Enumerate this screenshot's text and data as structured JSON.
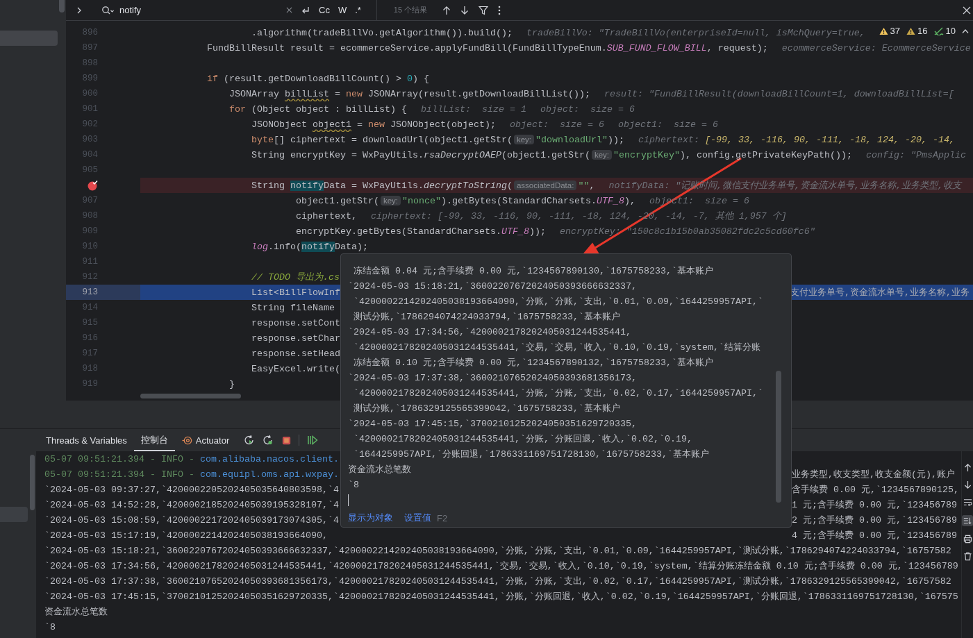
{
  "find_bar": {
    "query": "notify",
    "options": [
      "Cc",
      "W",
      ".*"
    ],
    "result_count": "15 个结果"
  },
  "inspections": [
    {
      "kind": "warning",
      "count": "37"
    },
    {
      "kind": "weak_warning",
      "count": "16"
    },
    {
      "kind": "typo",
      "count": "10"
    }
  ],
  "editor": {
    "lines": [
      {
        "number": "896",
        "breakpoint": false,
        "current": false,
        "segments": [
          {
            "kind": "plain",
            "text": "                    .algorithm(tradeBillVo.getAlgorithm()).build();"
          },
          {
            "kind": "hint",
            "text": "tradeBillVo: \"TradeBillVo(enterpriseId=null, isMchQuery=true,"
          }
        ]
      },
      {
        "number": "897",
        "breakpoint": false,
        "current": false,
        "segments": [
          {
            "kind": "plain",
            "text": "            FundBillResult result = ecommerceService.applyFundBill(FundBillTypeEnum."
          },
          {
            "kind": "constant",
            "text": "SUB_FUND_FLOW_BILL"
          },
          {
            "kind": "plain",
            "text": ", request);"
          },
          {
            "kind": "hint",
            "text": "ecommerceService: EcommerceService"
          }
        ]
      },
      {
        "number": "898",
        "breakpoint": false,
        "current": false
      },
      {
        "number": "899",
        "breakpoint": false,
        "current": false,
        "segments": [
          {
            "kind": "keyword",
            "text": "            if"
          },
          {
            "kind": "plain",
            "text": " (result.getDownloadBillCount() > "
          },
          {
            "kind": "number",
            "text": "0"
          },
          {
            "kind": "plain",
            "text": ") {"
          }
        ]
      },
      {
        "number": "900",
        "breakpoint": false,
        "current": false,
        "segments": [
          {
            "kind": "plain",
            "text": "                JSONArray "
          },
          {
            "kind": "warn",
            "text": "billList"
          },
          {
            "kind": "plain",
            "text": " = "
          },
          {
            "kind": "keyword",
            "text": "new"
          },
          {
            "kind": "plain",
            "text": " JSONArray(result.getDownloadBillList());"
          },
          {
            "kind": "hint",
            "text": "result: \"FundBillResult(downloadBillCount=1, downloadBillList=["
          }
        ]
      },
      {
        "number": "901",
        "breakpoint": false,
        "current": false,
        "segments": [
          {
            "kind": "keyword",
            "text": "                for"
          },
          {
            "kind": "plain",
            "text": " (Object object : billList) {"
          },
          {
            "kind": "hint",
            "text": "billList:  size = 1"
          },
          {
            "kind": "hint",
            "text": "object:  size = 6"
          }
        ]
      },
      {
        "number": "902",
        "breakpoint": false,
        "current": false,
        "segments": [
          {
            "kind": "plain",
            "text": "                    JSONObject "
          },
          {
            "kind": "warn",
            "text": "object1"
          },
          {
            "kind": "plain",
            "text": " = "
          },
          {
            "kind": "keyword",
            "text": "new"
          },
          {
            "kind": "plain",
            "text": " JSONObject(object);"
          },
          {
            "kind": "hint",
            "text": "object:  size = 6"
          },
          {
            "kind": "hint",
            "text": "object1:  size = 6"
          }
        ]
      },
      {
        "number": "903",
        "breakpoint": false,
        "current": false,
        "segments": [
          {
            "kind": "keyword",
            "text": "                    byte"
          },
          {
            "kind": "plain",
            "text": "[] ciphertext = downloadUrl(object1.getStr("
          },
          {
            "kind": "param",
            "text": "key:"
          },
          {
            "kind": "string",
            "text": "\"downloadUrl\""
          },
          {
            "kind": "plain",
            "text": "));"
          },
          {
            "kind": "hint",
            "text": "ciphertext:"
          },
          {
            "kind": "changed",
            "text": "[-99, 33, -116, 90, -111, -18, 124, -20, -14,"
          }
        ]
      },
      {
        "number": "904",
        "breakpoint": false,
        "current": false,
        "segments": [
          {
            "kind": "plain",
            "text": "                    String encryptKey = WxPayUtils."
          },
          {
            "kind": "static",
            "text": "rsaDecryptOAEP"
          },
          {
            "kind": "plain",
            "text": "(object1.getStr("
          },
          {
            "kind": "param",
            "text": "key:"
          },
          {
            "kind": "string",
            "text": "\"encryptKey\""
          },
          {
            "kind": "plain",
            "text": "), config.getPrivateKeyPath());"
          },
          {
            "kind": "hint",
            "text": "config: \"PmsApplic"
          }
        ]
      },
      {
        "number": "905",
        "breakpoint": false,
        "current": false
      },
      {
        "breakpoint": true,
        "current": false,
        "segments": [
          {
            "kind": "plain",
            "text": "                    String "
          },
          {
            "kind": "match",
            "text": "notify"
          },
          {
            "kind": "plain",
            "text": "Data = WxPayUtils."
          },
          {
            "kind": "static",
            "text": "decryptToString"
          },
          {
            "kind": "plain",
            "text": "("
          },
          {
            "kind": "param",
            "text": "associatedData:"
          },
          {
            "kind": "string",
            "text": "\"\""
          },
          {
            "kind": "plain",
            "text": ","
          },
          {
            "kind": "hint",
            "text": "notifyData: \"记账时间,微信支付业务单号,资金流水单号,业务名称,业务类型,收支"
          }
        ]
      },
      {
        "number": "907",
        "breakpoint": false,
        "current": false,
        "segments": [
          {
            "kind": "plain",
            "text": "                            object1.getStr("
          },
          {
            "kind": "param",
            "text": "key:"
          },
          {
            "kind": "string",
            "text": "\"nonce\""
          },
          {
            "kind": "plain",
            "text": ").getBytes(StandardCharsets."
          },
          {
            "kind": "constant",
            "text": "UTF_8"
          },
          {
            "kind": "plain",
            "text": "),"
          },
          {
            "kind": "hint",
            "text": "object1:  size = 6"
          }
        ]
      },
      {
        "number": "908",
        "breakpoint": false,
        "current": false,
        "segments": [
          {
            "kind": "plain",
            "text": "                            ciphertext,"
          },
          {
            "kind": "hint",
            "text": "ciphertext: [-99, 33, -116, 90, -111, -18, 124, -20, -14, -7, 其他 1,957 个]"
          }
        ]
      },
      {
        "number": "909",
        "breakpoint": false,
        "current": false,
        "segments": [
          {
            "kind": "plain",
            "text": "                            encryptKey.getBytes(StandardCharsets."
          },
          {
            "kind": "constant",
            "text": "UTF_8"
          },
          {
            "kind": "plain",
            "text": "));"
          },
          {
            "kind": "hint",
            "text": "encryptKey: \"150c8c1b15b0ab35082fdc2c5cd60fc6\""
          }
        ]
      },
      {
        "number": "910",
        "breakpoint": false,
        "current": false,
        "segments": [
          {
            "kind": "field",
            "text": "                    log"
          },
          {
            "kind": "plain",
            "text": ".info("
          },
          {
            "kind": "match",
            "text": "notify"
          },
          {
            "kind": "plain",
            "text": "Data);"
          }
        ]
      },
      {
        "number": "911",
        "breakpoint": false,
        "current": false
      },
      {
        "number": "912",
        "breakpoint": false,
        "current": false,
        "segments": [
          {
            "kind": "todo",
            "text": "                    // TODO 导出为.cs"
          }
        ]
      },
      {
        "number": "913",
        "breakpoint": false,
        "current": true,
        "segments": [
          {
            "kind": "plain",
            "text": "                    List<BillFlowInf"
          }
        ],
        "trailing": "支付业务单号,资金流水单号,业务名称,业务"
      },
      {
        "number": "914",
        "breakpoint": false,
        "current": false,
        "segments": [
          {
            "kind": "plain",
            "text": "                    String fileName"
          }
        ]
      },
      {
        "number": "915",
        "breakpoint": false,
        "current": false,
        "segments": [
          {
            "kind": "plain",
            "text": "                    response.setCont"
          }
        ]
      },
      {
        "number": "916",
        "breakpoint": false,
        "current": false,
        "segments": [
          {
            "kind": "plain",
            "text": "                    response.setChar"
          }
        ]
      },
      {
        "number": "917",
        "breakpoint": false,
        "current": false,
        "segments": [
          {
            "kind": "plain",
            "text": "                    response.setHead"
          }
        ]
      },
      {
        "number": "918",
        "breakpoint": false,
        "current": false,
        "segments": [
          {
            "kind": "plain",
            "text": "                    EasyExcel.write("
          }
        ]
      },
      {
        "number": "919",
        "breakpoint": false,
        "current": false,
        "segments": [
          {
            "kind": "plain",
            "text": "                }"
          }
        ]
      }
    ]
  },
  "popup": {
    "lines": [
      " 冻结金额 0.04 元;含手续费 0.00 元,`1234567890130,`1675758233,`基本账户",
      "`2024-05-03 15:18:21,`36002207672024050393666632337,",
      " `4200002214202405038193664090,`分账,`分账,`支出,`0.01,`0.09,`1644259957API,`",
      " 测试分账,`1786294074224033794,`1675758233,`基本账户",
      "`2024-05-03 17:34:56,`4200002178202405031244535441,",
      " `4200002178202405031244535441,`交易,`交易,`收入,`0.10,`0.19,`system,`结算分账",
      " 冻结金额 0.10 元;含手续费 0.00 元,`1234567890132,`1675758233,`基本账户",
      "`2024-05-03 17:37:38,`36002107652024050393681356173,",
      " `4200002178202405031244535441,`分账,`分账,`支出,`0.02,`0.17,`1644259957API,`",
      " 测试分账,`1786329125565399042,`1675758233,`基本账户",
      "`2024-05-03 17:45:15,`37002101252024050351629720335,",
      " `4200002178202405031244535441,`分账,`分账回退,`收入,`0.02,`0.19,",
      " `1644259957API,`分账回退,`1786331169751728130,`1675758233,`基本账户",
      "资金流水总笔数",
      "`8"
    ],
    "links": [
      "显示为对象",
      "设置值"
    ],
    "shortcut": "F2"
  },
  "tool_window": {
    "tabs": [
      {
        "label": "Threads & Variables",
        "selected": false,
        "kind": "plain"
      },
      {
        "label": "控制台",
        "selected": true,
        "kind": "plain"
      },
      {
        "label": "Actuator",
        "selected": false,
        "kind": "plugin"
      }
    ]
  },
  "console": {
    "autoscroll": true,
    "lines": [
      {
        "left": [
          {
            "kind": "meta",
            "text": "05-07 09:51:21.394 - INFO - "
          },
          {
            "kind": "logger",
            "text": "com.alibaba.nacos.client."
          }
        ]
      },
      {
        "left": [
          {
            "kind": "meta",
            "text": "05-07 09:51:21.394 - INFO - "
          },
          {
            "kind": "logger",
            "text": "com.equipl.oms.api.wxpay."
          }
        ],
        "right": "业务类型,收支类型,收支金额(元),账户"
      },
      {
        "left": [
          {
            "kind": "plain",
            "text": "`2024-05-03 09:37:27,`4200002205202405035640803598,`4"
          }
        ],
        "right": "含手续费 0.00 元,`1234567890125,"
      },
      {
        "left": [
          {
            "kind": "plain",
            "text": "`2024-05-03 14:52:28,`4200002185202405039195328107,`4"
          }
        ],
        "right": "1 元;含手续费 0.00 元,`123456789"
      },
      {
        "left": [
          {
            "kind": "plain",
            "text": "`2024-05-03 15:08:59,`4200002217202405039173074305,`4"
          }
        ],
        "right": "2 元;含手续费 0.00 元,`123456789"
      },
      {
        "left": [
          {
            "kind": "plain",
            "text": "`2024-05-03 15:17:19,`4200002214202405038193664090,"
          }
        ],
        "right": "4 元;含手续费 0.00 元,`123456789"
      },
      {
        "left": [
          {
            "kind": "plain",
            "text": "`2024-05-03 15:18:21,`36002207672024050393666632337,`4200002214202405038193664090,`分账,`分账,`支出,`0.01,`0.09,`1644259957API,`测试分账,`1786294074224033794,`16757582"
          }
        ]
      },
      {
        "left": [
          {
            "kind": "plain",
            "text": "`2024-05-03 17:34:56,`4200002178202405031244535441,`4200002178202405031244535441,`交易,`交易,`收入,`0.10,`0.19,`system,`结算分账冻结金额 0.10 元;含手续费 0.00 元,`123456789"
          }
        ]
      },
      {
        "left": [
          {
            "kind": "plain",
            "text": "`2024-05-03 17:37:38,`36002107652024050393681356173,`4200002178202405031244535441,`分账,`分账,`支出,`0.02,`0.17,`1644259957API,`测试分账,`1786329125565399042,`16757582"
          }
        ]
      },
      {
        "left": [
          {
            "kind": "plain",
            "text": "`2024-05-03 17:45:15,`37002101252024050351629720335,`4200002178202405031244535441,`分账,`分账回退,`收入,`0.02,`0.19,`1644259957API,`分账回退,`1786331169751728130,`167575"
          }
        ]
      },
      {
        "left": [
          {
            "kind": "plain",
            "text": "资金流水总笔数"
          }
        ]
      },
      {
        "left": [
          {
            "kind": "plain",
            "text": "`8"
          }
        ]
      }
    ]
  }
}
